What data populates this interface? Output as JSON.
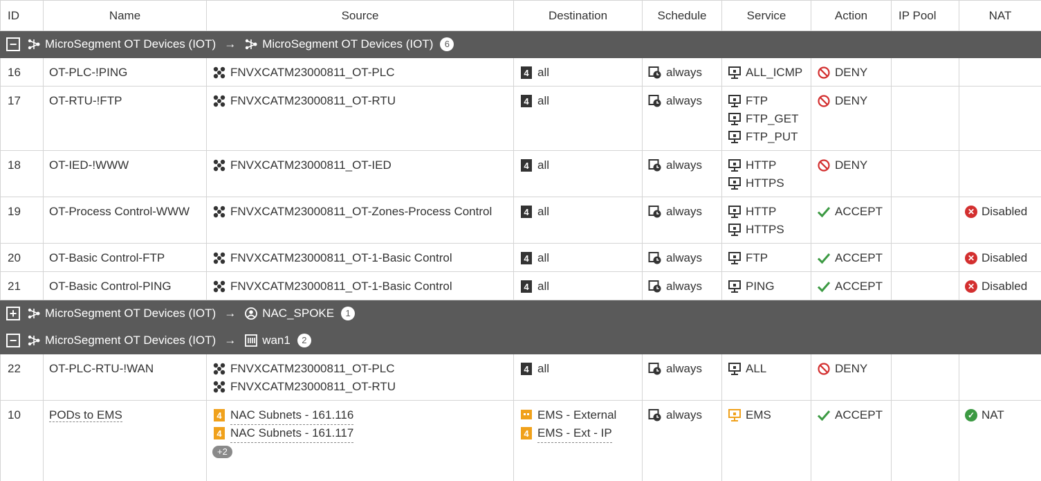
{
  "columns": [
    "ID",
    "Name",
    "Source",
    "Destination",
    "Schedule",
    "Service",
    "Action",
    "IP Pool",
    "NAT"
  ],
  "groups": {
    "g1": {
      "toggle": "−",
      "from": "MicroSegment OT Devices (IOT)",
      "arrow": "→",
      "to": "MicroSegment OT Devices (IOT)",
      "count": "6"
    },
    "g2": {
      "toggle": "+",
      "from": "MicroSegment OT Devices (IOT)",
      "arrow": "→",
      "to": "NAC_SPOKE",
      "count": "1"
    },
    "g3": {
      "toggle": "−",
      "from": "MicroSegment OT Devices (IOT)",
      "arrow": "→",
      "to": "wan1",
      "count": "2"
    }
  },
  "rows": {
    "r16": {
      "id": "16",
      "name": "OT-PLC-!PING",
      "source": [
        "FNVXCATM23000811_OT-PLC"
      ],
      "dest": [
        "all"
      ],
      "schedule": "always",
      "service": [
        "ALL_ICMP"
      ],
      "action": "DENY",
      "nat": ""
    },
    "r17": {
      "id": "17",
      "name": "OT-RTU-!FTP",
      "source": [
        "FNVXCATM23000811_OT-RTU"
      ],
      "dest": [
        "all"
      ],
      "schedule": "always",
      "service": [
        "FTP",
        "FTP_GET",
        "FTP_PUT"
      ],
      "action": "DENY",
      "nat": ""
    },
    "r18": {
      "id": "18",
      "name": "OT-IED-!WWW",
      "source": [
        "FNVXCATM23000811_OT-IED"
      ],
      "dest": [
        "all"
      ],
      "schedule": "always",
      "service": [
        "HTTP",
        "HTTPS"
      ],
      "action": "DENY",
      "nat": ""
    },
    "r19": {
      "id": "19",
      "name": "OT-Process Control-WWW",
      "source": [
        "FNVXCATM23000811_OT-Zones-Process Control"
      ],
      "dest": [
        "all"
      ],
      "schedule": "always",
      "service": [
        "HTTP",
        "HTTPS"
      ],
      "action": "ACCEPT",
      "nat": "Disabled"
    },
    "r20": {
      "id": "20",
      "name": "OT-Basic Control-FTP",
      "source": [
        "FNVXCATM23000811_OT-1-Basic Control"
      ],
      "dest": [
        "all"
      ],
      "schedule": "always",
      "service": [
        "FTP"
      ],
      "action": "ACCEPT",
      "nat": "Disabled"
    },
    "r21": {
      "id": "21",
      "name": "OT-Basic Control-PING",
      "source": [
        "FNVXCATM23000811_OT-1-Basic Control"
      ],
      "dest": [
        "all"
      ],
      "schedule": "always",
      "service": [
        "PING"
      ],
      "action": "ACCEPT",
      "nat": "Disabled"
    },
    "r22": {
      "id": "22",
      "name": "OT-PLC-RTU-!WAN",
      "source": [
        "FNVXCATM23000811_OT-PLC",
        "FNVXCATM23000811_OT-RTU"
      ],
      "dest": [
        "all"
      ],
      "schedule": "always",
      "service": [
        "ALL"
      ],
      "action": "DENY",
      "nat": ""
    },
    "r10": {
      "id": "10",
      "name": "PODs to EMS",
      "source": [
        "NAC Subnets - 161.116",
        "NAC Subnets - 161.117"
      ],
      "source_more": "+2",
      "dest": [
        "EMS - External",
        "EMS - Ext - IP"
      ],
      "schedule": "always",
      "service": [
        "EMS"
      ],
      "action": "ACCEPT",
      "nat": "NAT"
    }
  },
  "colors": {
    "group_bg": "#5a5a5a",
    "deny": "#d32f2f",
    "accept": "#3c9a43",
    "address_yellow": "#f0a11b"
  }
}
